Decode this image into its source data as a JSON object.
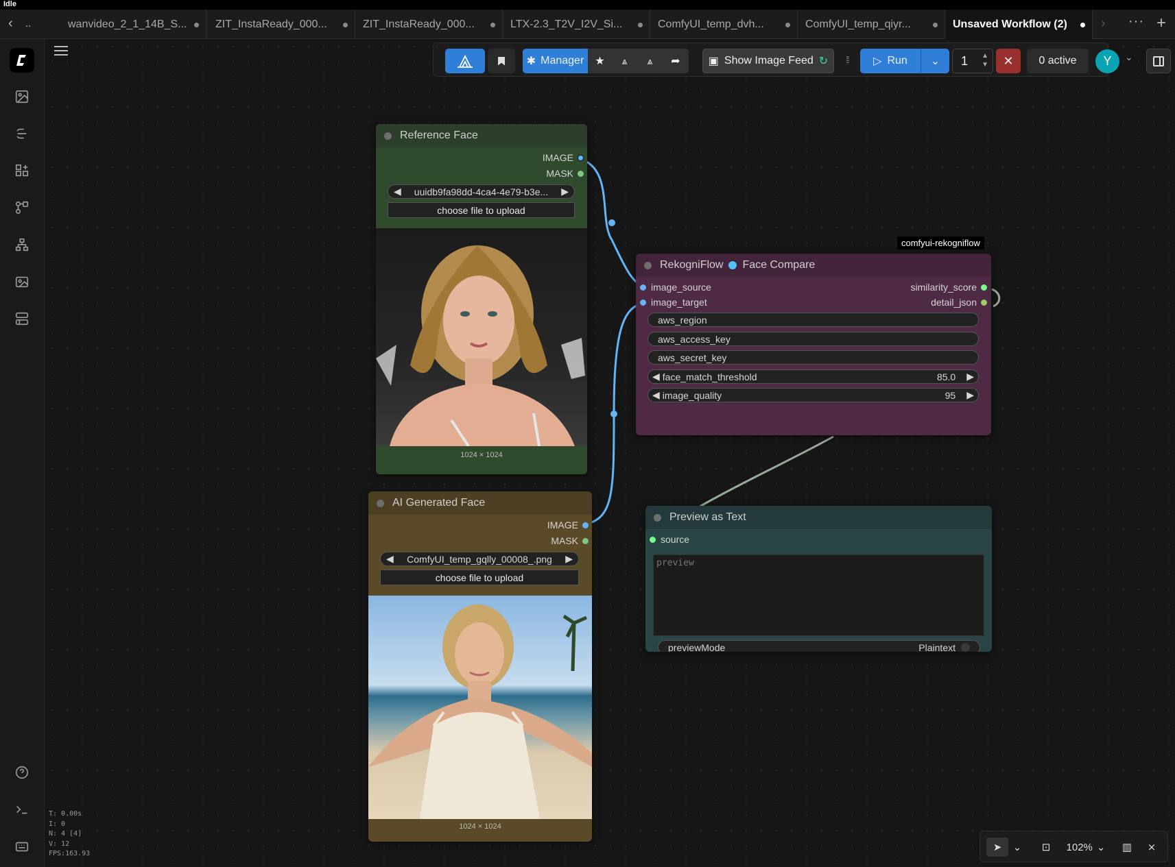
{
  "window": {
    "status": "Idle"
  },
  "tabs": {
    "back_label": "..",
    "items": [
      {
        "label": "wanvideo_2_1_14B_S..."
      },
      {
        "label": "ZIT_InstaReady_000..."
      },
      {
        "label": "ZIT_InstaReady_000..."
      },
      {
        "label": "LTX-2.3_T2V_I2V_Si..."
      },
      {
        "label": "ComfyUI_temp_dvh..."
      },
      {
        "label": "ComfyUI_temp_qiyr..."
      },
      {
        "label": "Unsaved Workflow (2)",
        "active": true
      }
    ]
  },
  "toolbar": {
    "manager_label": "Manager",
    "image_feed_label": "Show Image Feed",
    "run_label": "Run",
    "queue_count": "1",
    "active_label": "0 active",
    "avatar_letter": "Y",
    "accent_color": "#2f7fd8",
    "avatar_color": "#0aa3b3"
  },
  "nodes": {
    "reference_face": {
      "title": "Reference Face",
      "outputs": [
        "IMAGE",
        "MASK"
      ],
      "image_value": "uuidb9fa98dd-4ca4-4e79-b3e...",
      "upload_label": "choose file to upload",
      "image_size": "1024 × 1024",
      "color": "#2f4a2c"
    },
    "ai_generated_face": {
      "title": "AI Generated Face",
      "outputs": [
        "IMAGE",
        "MASK"
      ],
      "image_value": "ComfyUI_temp_gqlly_00008_.png",
      "upload_label": "choose file to upload",
      "image_size": "1024 × 1024",
      "color": "#5a4a28"
    },
    "face_compare": {
      "badge": "comfyui-rekogniflow",
      "title_prefix": "RekogniFlow",
      "title": "Face Compare",
      "inputs": [
        "image_source",
        "image_target"
      ],
      "outputs": [
        "similarity_score",
        "detail_json"
      ],
      "widgets": [
        {
          "label": "aws_region"
        },
        {
          "label": "aws_access_key"
        },
        {
          "label": "aws_secret_key"
        },
        {
          "label": "face_match_threshold",
          "value": "85.0"
        },
        {
          "label": "image_quality",
          "value": "95"
        }
      ],
      "color": "#4e2a44"
    },
    "preview_text": {
      "title": "Preview as Text",
      "input": "source",
      "placeholder": "preview",
      "mode_label": "previewMode",
      "mode_value": "Plaintext",
      "color": "#2a4545"
    }
  },
  "stats": {
    "t": "T: 0.00s",
    "i": "I: 0",
    "n": "N: 4 [4]",
    "v": "V: 12",
    "fps": "FPS:163.93"
  },
  "zoom": {
    "level": "102%"
  }
}
